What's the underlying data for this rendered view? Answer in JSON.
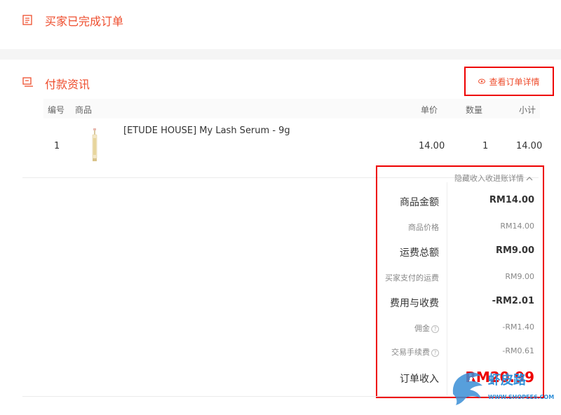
{
  "status": {
    "text": "买家已完成订单",
    "icon": "receipt-icon"
  },
  "payment": {
    "title": "付款资讯",
    "view_details": "查看订单详情",
    "table": {
      "headers": {
        "no": "编号",
        "product": "商品",
        "unit_price": "单价",
        "quantity": "数量",
        "subtotal": "小计"
      },
      "rows": [
        {
          "no": "1",
          "name": "[ETUDE HOUSE] My Lash Serum - 9g",
          "unit_price": "14.00",
          "quantity": "1",
          "subtotal": "14.00"
        }
      ]
    },
    "income": {
      "toggle": "隐藏收入收进账详情",
      "items": [
        {
          "label": "商品金额",
          "value": "RM14.00"
        },
        {
          "label": "商品价格",
          "value": "RM14.00"
        },
        {
          "label": "运费总额",
          "value": "RM9.00"
        },
        {
          "label": "买家支付的运费",
          "value": "RM9.00"
        },
        {
          "label": "费用与收费",
          "value": "-RM2.01"
        },
        {
          "label": "佣金",
          "value": "-RM1.40"
        },
        {
          "label": "交易手续费",
          "value": "-RM0.61"
        }
      ],
      "total_label": "订单收入",
      "total_value": "RM20.99"
    }
  },
  "watermark": {
    "text": "虾皮路",
    "url": "WWW.SHOPEE6.COM"
  },
  "colors": {
    "accent": "#ee4d2d",
    "highlight_border": "#e00000",
    "watermark": "#2f8fd8"
  }
}
